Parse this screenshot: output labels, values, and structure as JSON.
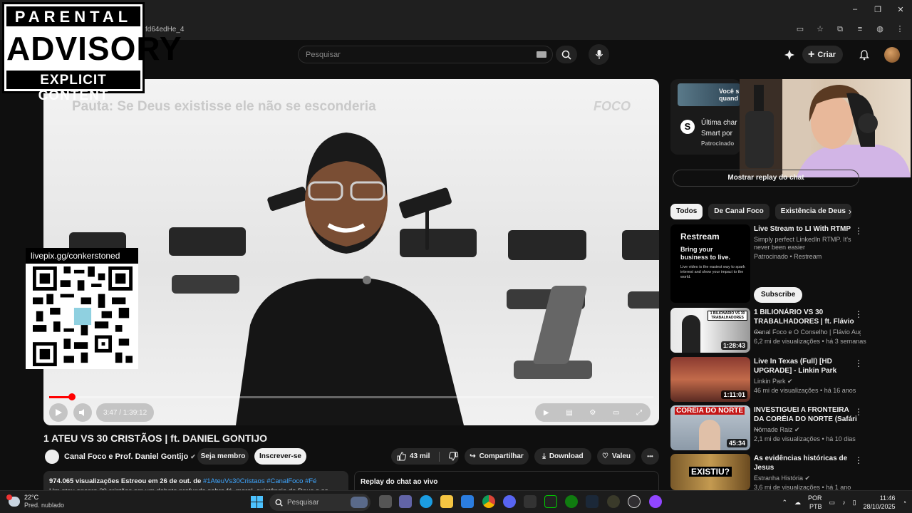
{
  "browser": {
    "url_fragment": "fd64edHe_4",
    "window_controls": {
      "minimize": "–",
      "maximize": "❐",
      "close": "✕"
    }
  },
  "header": {
    "search_placeholder": "Pesquisar",
    "create_label": "Criar"
  },
  "overlay_parental": {
    "top": "PARENTAL",
    "middle": "ADVISORY",
    "bottom": "EXPLICIT CONTENT"
  },
  "overlay_qr": {
    "label": "livepix.gg/conkerstoned"
  },
  "player": {
    "banner_text": "Pauta: Se Deus existisse ele não se esconderia",
    "brand": "FOCO",
    "time_label": "3:47 / 1:39:12",
    "progress": 0.038
  },
  "video": {
    "title": "1 ATEU VS 30 CRISTÃOS | ft. DANIEL GONTIJO",
    "channel": "Canal Foco e Prof. Daniel Gontijo",
    "join_label": "Seja membro",
    "subscribe_label": "Inscrever-se",
    "likes": "43 mil",
    "share_label": "Compartilhar",
    "download_label": "Download",
    "thanks_label": "Valeu",
    "more_label": "•••"
  },
  "description": {
    "stats": "974.065 visualizações  Estreou em 26 de out. de",
    "tags": "#1AteuVs30Cristaos #CanalFoco #Fé",
    "line2": "Um ateu encara 30 cristãos em um debate profundo sobre fé, moral, existência de Deus e se"
  },
  "chat": {
    "replay_label": "Replay do chat ao vivo",
    "show_replay_label": "Mostrar replay do chat"
  },
  "ad_card": {
    "text1": "Você s",
    "text2": "quand",
    "title1": "Última char",
    "title2": "Smart por",
    "sponsored": "Patrocinado"
  },
  "chips": {
    "items": [
      "Todos",
      "De Canal Foco",
      "Existência de Deus"
    ],
    "next": "›"
  },
  "recommendations": [
    {
      "title": "Live Stream to LI With RTMP",
      "channel": "Simply perfect LinkedIn RTMP. It's never been easier",
      "meta": "Patrocinado • Restream",
      "thumb_title": "Restream",
      "thumb_heading": "Bring your business to live.",
      "thumb_body": "Live video is the easiest way to spark interest and show your impact to the world.",
      "cta": "Subscribe"
    },
    {
      "title": "1 BILIONÁRIO VS 30 TRABALHADORES | ft. Flávio ...",
      "channel": "Canal Foco e O Conselho | Flávio August...",
      "meta": "6,2 mi de visualizações • há 3 semanas",
      "duration": "1:28:43",
      "thumb_badge": "1 BILIONÁRIO VS 30 TRABALHADORES"
    },
    {
      "title": "Live In Texas (Full) [HD UPGRADE] - Linkin Park",
      "channel": "Linkin Park",
      "meta": "46 mi de visualizações • há 16 anos",
      "duration": "1:11:01"
    },
    {
      "title": "INVESTIGUEI A FRONTEIRA DA CORÉIA DO NORTE (Safári ...",
      "channel": "Nômade Raiz",
      "meta": "2,1 mi de visualizações • há 10 dias",
      "duration": "45:34",
      "thumb_badge": "COREIA DO NORTE"
    },
    {
      "title": "As evidências históricas de Jesus",
      "channel": "Estranha História",
      "meta": "3,6 mi de visualizações • há 1 ano",
      "thumb_badge": "EXISTIU?"
    }
  ],
  "taskbar": {
    "temperature": "22°C",
    "weather": "Pred. nublado",
    "search_label": "Pesquisar",
    "language": "POR",
    "layout": "PTB",
    "time": "11:46",
    "date": "28/10/2025"
  },
  "colors": {
    "accent_red": "#ff0000",
    "bg": "#0f0f0f",
    "link_blue": "#3ea6ff"
  }
}
